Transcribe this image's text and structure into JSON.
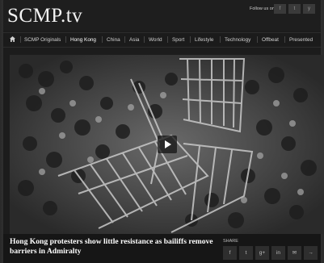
{
  "header": {
    "logo": "SCMP.tv",
    "follow_text": "Follow us on",
    "social_top": [
      "f",
      "t",
      "y"
    ]
  },
  "nav": {
    "items": [
      "SCMP Originals",
      "Hong Kong",
      "China",
      "Asia",
      "World",
      "Sport",
      "Lifestyle",
      "Technology",
      "Offbeat",
      "Presented"
    ],
    "active": "Hong Kong"
  },
  "video": {
    "title": "Hong Kong protesters show little resistance as bailiffs remove barriers in Admiralty"
  },
  "share": {
    "label": "SHARE",
    "buttons": [
      "f",
      "t",
      "g+",
      "in",
      "✉",
      "→"
    ]
  }
}
